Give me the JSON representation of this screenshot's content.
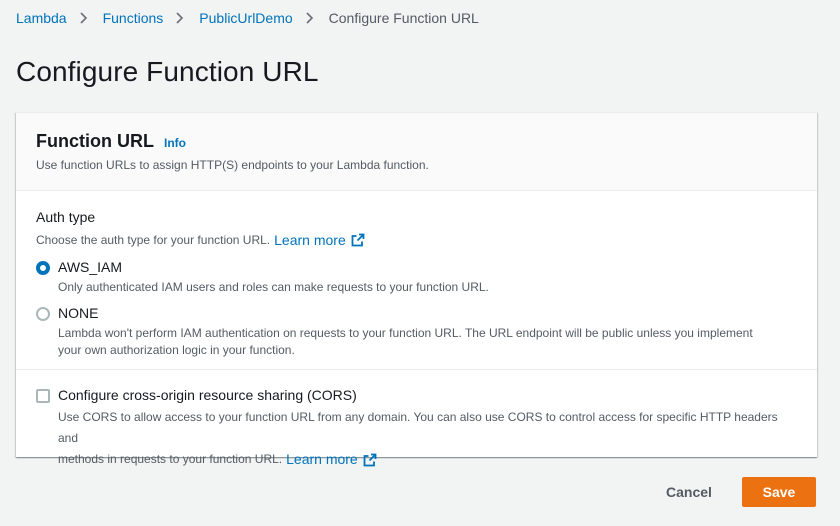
{
  "breadcrumb": {
    "items": [
      {
        "label": "Lambda"
      },
      {
        "label": "Functions"
      },
      {
        "label": "PublicUrlDemo"
      },
      {
        "label": "Configure Function URL"
      }
    ]
  },
  "page": {
    "title": "Configure Function URL"
  },
  "panel": {
    "title": "Function URL",
    "info_label": "Info",
    "description": "Use function URLs to assign HTTP(S) endpoints to your Lambda function."
  },
  "auth": {
    "label": "Auth type",
    "description": "Choose the auth type for your function URL.",
    "learn_more": "Learn more",
    "selected": "AWS_IAM",
    "options": [
      {
        "label": "AWS_IAM",
        "description": "Only authenticated IAM users and roles can make requests to your function URL."
      },
      {
        "label": "NONE",
        "description_line1": "Lambda won't perform IAM authentication on requests to your function URL. The URL endpoint will be public unless you implement",
        "description_line2": "your own authorization logic in your function."
      }
    ]
  },
  "cors": {
    "label": "Configure cross-origin resource sharing (CORS)",
    "checked": false,
    "description_line1": "Use CORS to allow access to your function URL from any domain. You can also use CORS to control access for specific HTTP headers and",
    "description_line2": "methods in requests to your function URL.",
    "learn_more": "Learn more"
  },
  "actions": {
    "cancel_label": "Cancel",
    "save_label": "Save"
  },
  "colors": {
    "link": "#0073bb",
    "primary_button": "#ec7211",
    "background": "#f2f3f3"
  }
}
